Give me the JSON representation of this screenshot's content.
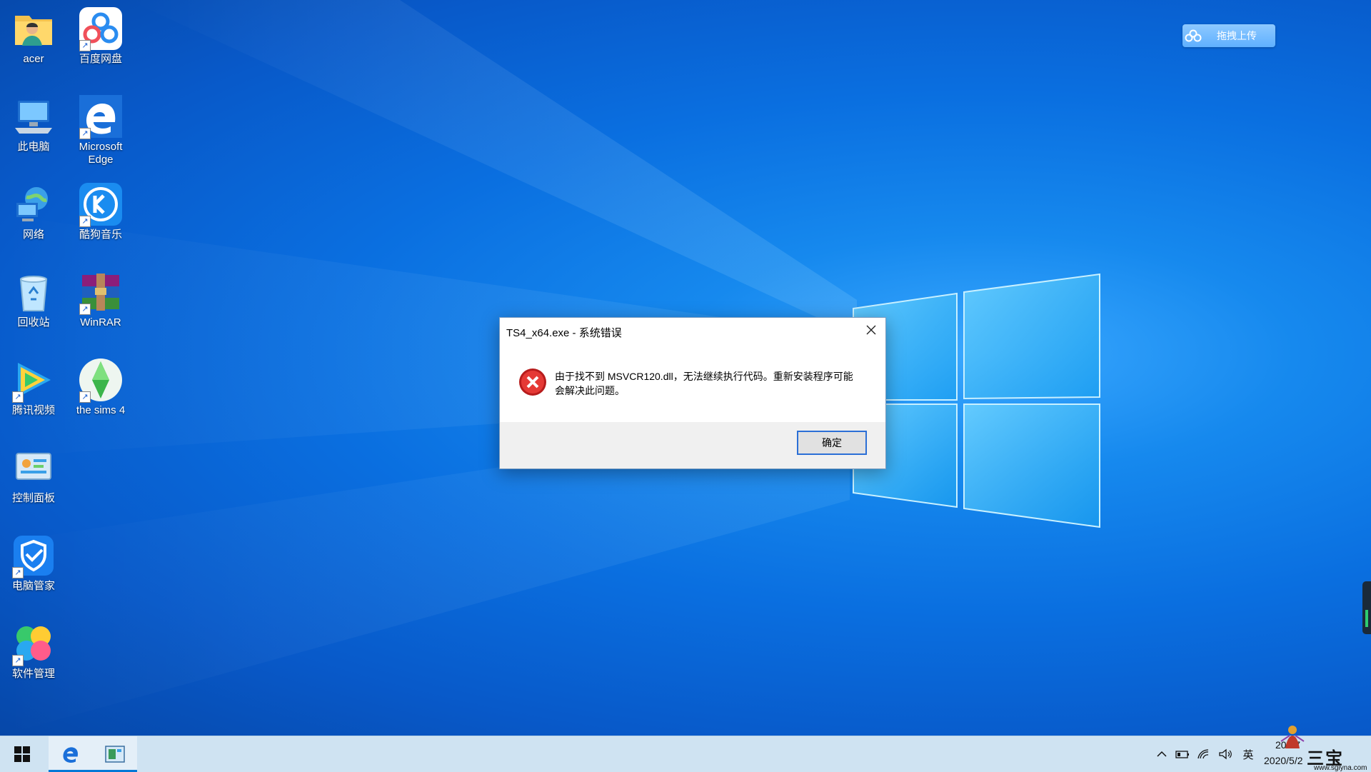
{
  "desktop": {
    "icons": [
      {
        "label": "acer",
        "icon": "user-folder-icon",
        "shortcut": false
      },
      {
        "label": "百度网盘",
        "icon": "baidu-netdisk-icon",
        "shortcut": true
      },
      {
        "label": "此电脑",
        "icon": "this-pc-icon",
        "shortcut": false
      },
      {
        "label": "Microsoft Edge",
        "icon": "edge-icon",
        "shortcut": true
      },
      {
        "label": "网络",
        "icon": "network-icon",
        "shortcut": false
      },
      {
        "label": "酷狗音乐",
        "icon": "kugou-music-icon",
        "shortcut": true
      },
      {
        "label": "回收站",
        "icon": "recycle-bin-icon",
        "shortcut": false
      },
      {
        "label": "WinRAR",
        "icon": "winrar-icon",
        "shortcut": true
      },
      {
        "label": "腾讯视频",
        "icon": "tencent-video-icon",
        "shortcut": true
      },
      {
        "label": "the sims 4",
        "icon": "sims4-icon",
        "shortcut": true
      },
      {
        "label": "控制面板",
        "icon": "control-panel-icon",
        "shortcut": false
      },
      {
        "label": "电脑管家",
        "icon": "pc-manager-icon",
        "shortcut": true
      },
      {
        "label": "软件管理",
        "icon": "software-manager-icon",
        "shortcut": true
      }
    ],
    "shortcut_glyph": "↗"
  },
  "upload_pill": {
    "label": "拖拽上传",
    "icon": "baidu-cloud-icon"
  },
  "dialog": {
    "title": "TS4_x64.exe - 系统错误",
    "close_glyph": "✕",
    "message_line1": "由于找不到 MSVCR120.dll，无法继续执行代码。重新安装程序可能",
    "message_line2": "会解决此问题。",
    "ok_label": "确定",
    "error_icon": "error-x-icon"
  },
  "taskbar": {
    "start_icon": "windows-start-icon",
    "pinned": [
      {
        "name": "edge",
        "icon": "edge-icon",
        "active": true
      },
      {
        "name": "control-panel",
        "icon": "control-panel-icon",
        "active": true
      }
    ],
    "tray": {
      "chevron": "^",
      "ime": "英",
      "time": "20:57",
      "date": "2020/5/2"
    }
  },
  "watermark": {
    "text": "三宝",
    "url": "www.sgiyna.com"
  },
  "colors": {
    "desktop_blue": "#0a6fe0",
    "taskbar": "#cfe3f2",
    "accent": "#0078d7",
    "error_red": "#d32f2f"
  }
}
